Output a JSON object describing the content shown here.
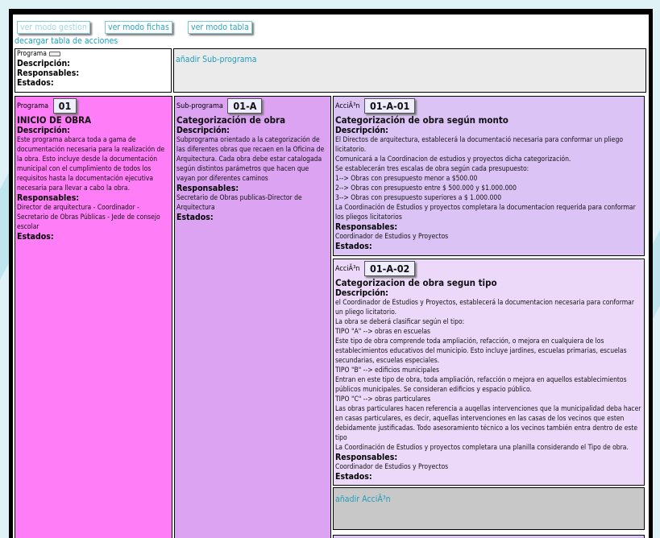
{
  "toolbar": {
    "btn_gestion": "ver modo gestion",
    "btn_fichas": "ver modo fichas",
    "btn_tabla": "ver modo tabla"
  },
  "download_link": "decargar tabla de acciones",
  "header_row": {
    "programa_label": "Programa",
    "descripcion_label": "Descripción:",
    "responsables_label": "Responsables:",
    "estados_label": "Estados:",
    "add_subprogram": "añadir Sub-programa"
  },
  "programa": {
    "label": "Programa",
    "code": "01",
    "title": "INICIO DE OBRA",
    "descripcion_label": "Descripción:",
    "descripcion": "Este programa abarca toda a gama de documentación necesaria para la realización de la obra. Esto incluye desde la documentación municipal con el cumplimiento de todos los requisitos hasta la documentación ejecutiva necesaria para llevar a cabo la obra.",
    "responsables_label": "Responsables:",
    "responsables": "Director de arquitectura - Coordinador - Secretario de Obras Públicas - Jede de consejo escolar",
    "estados_label": "Estados:"
  },
  "subprograma": {
    "label": "Sub-programa",
    "code": "01-A",
    "title": "Categorización de obra",
    "descripcion_label": "Descripción:",
    "descripcion": "Subprograma orientado a la categorización de las diferentes obras que recaen en la Oficina de Arquitectura. Cada obra debe estar catalogada según distintos parámetros que hacen que vayan por diferentes caminos",
    "responsables_label": "Responsables:",
    "responsables": "Secretario de Obras publicas-Director de Arquitectura",
    "estados_label": "Estados:"
  },
  "acciones": [
    {
      "label": "AcciÃ³n",
      "code": "01-A-01",
      "title": "Categorización de obra según monto",
      "descripcion_label": "Descripción:",
      "lines": [
        "El Directos de arquitectura, establecerá la documentació necesaria para conformar un pliego licitatorio.",
        "Comunicará a la Coordinacion de estudios y proyectos dicha categorización.",
        "Se establecerán tres escalas de obra según cada presupuesto:",
        "1--> Obras con presupuesto menor a $500.00",
        "2--> Obras con presupuesto entre $ 500.000 y $1.000.000",
        "3--> Obras con presupuesto superiores a $ 1.000.000",
        "La Coordinación de Estudios y proyectos  completara la documentacion requerida para conformar los pliegos licitatorios"
      ],
      "responsables_label": "Responsables:",
      "responsables": "Coordinador de Estudios y Proyectos",
      "estados_label": "Estados:"
    },
    {
      "label": "AcciÃ³n",
      "code": "01-A-02",
      "title": "Categorizacion de obra segun tipo",
      "descripcion_label": "Descripción:",
      "lines": [
        "el Coordinador de Estudios y Proyectos, establecerá la documentacion necesaria para conformar un pliego licitatorio.",
        "La obra se deberá clasificar según el tipo:",
        "TIPO \"A\" --> obras en escuelas",
        "Este tipo de obra comprende toda ampliación, refacción, o mejora en cualquiera de los establecimientos educativos del municipio. Esto incluye jardines, escuelas primarias, escuelas secundarias, escuelas especiales.",
        "TIPO \"B\" --> edificios municipales",
        "Entran en este tipo de obra, toda ampliación, refacción o mejora en aquellos establecimientos públicos municipales. Se consideran edificios y espacio público.",
        "TIPO \"C\" --> obras particulares",
        "Las obras particulares hacen referencia a auqellas intervenciones que la municipalidad deba hacer en casas particulares, es decir, aquellas intervenciones en las casas de los vecinos que esten debidamente justificadas. Todo asesoramiento técnico a los vecinos también entra dentro de este tipo",
        "La Coordinación de Estudios y proyectos  completara una planilla considerando el Tipo de obra."
      ],
      "responsables_label": "Responsables:",
      "responsables": "Coordinador de Estudios y Proyectos",
      "estados_label": "Estados:"
    }
  ],
  "add_accion": "añadir AcciÃ³n"
}
